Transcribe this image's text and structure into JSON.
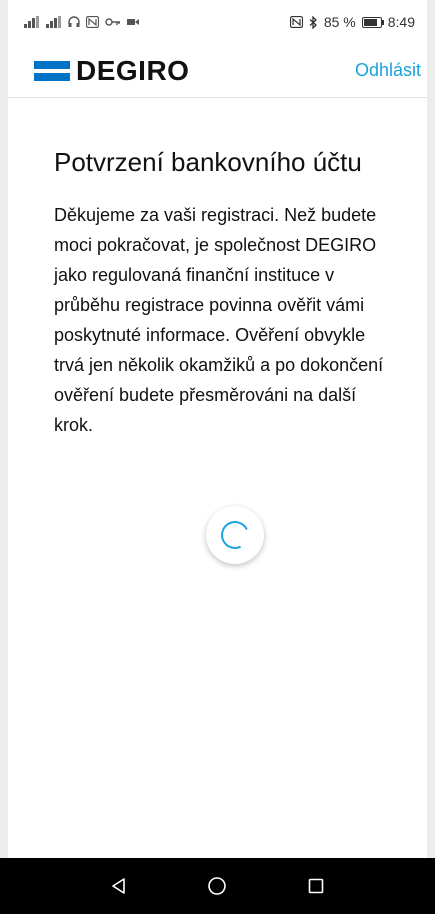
{
  "status_bar": {
    "left_icons": [
      "signal-icon",
      "signal-icon",
      "headset-icon",
      "nfc-icon",
      "key-icon",
      "video-icon"
    ],
    "battery_percent": "85 %",
    "time": "8:49"
  },
  "header": {
    "logo_text": "DEGIRO",
    "logout_label": "Odhlásit",
    "brand_color": "#0073c6",
    "link_color": "#1aa2dc"
  },
  "main": {
    "title": "Potvrzení bankovního účtu",
    "message": "Děkujeme za vaši registraci. Než budete moci pokračovat, je společnost DEGIRO jako regulovaná finanční instituce v průběhu registrace povinna ověřit vámi poskytnuté informace. Ověření obvykle trvá jen několik okamžiků a po dokončení ověření budete přesměrováni na další krok."
  },
  "loading": {
    "icon": "spinner-icon"
  },
  "nav_bar": {
    "buttons": [
      "back-icon",
      "home-icon",
      "recents-icon"
    ]
  }
}
